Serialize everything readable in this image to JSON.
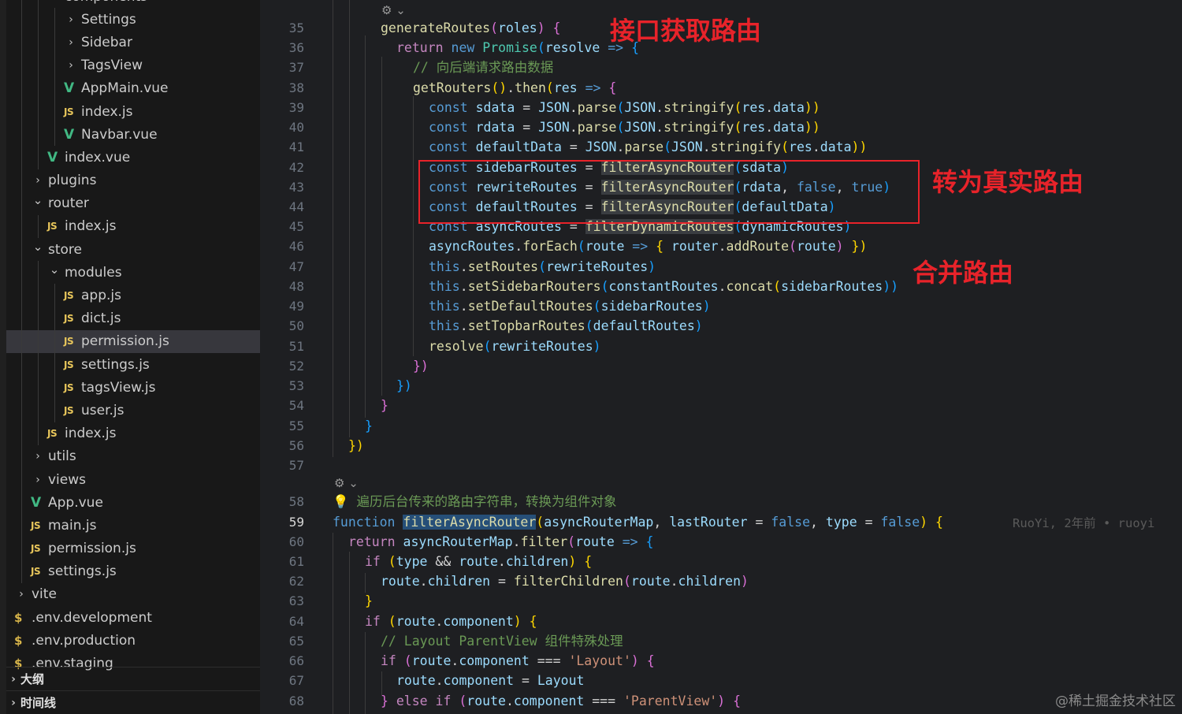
{
  "sidebar": {
    "items": [
      {
        "label": "components",
        "type": "folder-open",
        "depth": 2
      },
      {
        "label": "Settings",
        "type": "folder",
        "depth": 3
      },
      {
        "label": "Sidebar",
        "type": "folder",
        "depth": 3
      },
      {
        "label": "TagsView",
        "type": "folder",
        "depth": 3
      },
      {
        "label": "AppMain.vue",
        "type": "vue",
        "depth": 3
      },
      {
        "label": "index.js",
        "type": "js",
        "depth": 3
      },
      {
        "label": "Navbar.vue",
        "type": "vue",
        "depth": 3
      },
      {
        "label": "index.vue",
        "type": "vue",
        "depth": 2
      },
      {
        "label": "plugins",
        "type": "folder",
        "depth": 1
      },
      {
        "label": "router",
        "type": "folder-open",
        "depth": 1
      },
      {
        "label": "index.js",
        "type": "js",
        "depth": 2
      },
      {
        "label": "store",
        "type": "folder-open",
        "depth": 1
      },
      {
        "label": "modules",
        "type": "folder-open",
        "depth": 2
      },
      {
        "label": "app.js",
        "type": "js",
        "depth": 3
      },
      {
        "label": "dict.js",
        "type": "js",
        "depth": 3
      },
      {
        "label": "permission.js",
        "type": "js",
        "depth": 3,
        "selected": true
      },
      {
        "label": "settings.js",
        "type": "js",
        "depth": 3
      },
      {
        "label": "tagsView.js",
        "type": "js",
        "depth": 3
      },
      {
        "label": "user.js",
        "type": "js",
        "depth": 3
      },
      {
        "label": "index.js",
        "type": "js",
        "depth": 2
      },
      {
        "label": "utils",
        "type": "folder",
        "depth": 1
      },
      {
        "label": "views",
        "type": "folder",
        "depth": 1
      },
      {
        "label": "App.vue",
        "type": "vue",
        "depth": 1
      },
      {
        "label": "main.js",
        "type": "js",
        "depth": 1
      },
      {
        "label": "permission.js",
        "type": "js",
        "depth": 1
      },
      {
        "label": "settings.js",
        "type": "js",
        "depth": 1
      },
      {
        "label": "vite",
        "type": "folder",
        "depth": 0
      },
      {
        "label": ".env.development",
        "type": "env",
        "depth": 0
      },
      {
        "label": ".env.production",
        "type": "env",
        "depth": 0
      },
      {
        "label": ".env.staging",
        "type": "env",
        "depth": 0
      }
    ],
    "panels": [
      {
        "label": "大纲"
      },
      {
        "label": "时间线"
      }
    ]
  },
  "icons": {
    "js": "JS",
    "vue": "V",
    "env": "$",
    "chevron_right": "chevron-right-icon",
    "chevron_down": "chevron-down-icon"
  },
  "editor": {
    "line_numbers": [
      "35",
      "36",
      "37",
      "38",
      "39",
      "40",
      "41",
      "42",
      "43",
      "44",
      "45",
      "46",
      "47",
      "48",
      "49",
      "50",
      "51",
      "52",
      "53",
      "54",
      "55",
      "56",
      "57",
      "58",
      "59",
      "60",
      "61",
      "62",
      "63",
      "64",
      "65",
      "66",
      "67",
      "68"
    ],
    "active_line": "59",
    "blame": "RuoYi, 2年前 • ruoyi",
    "lines": {
      "l35": [
        "generateRoutes",
        "(",
        "roles",
        ")",
        " {"
      ],
      "l36": [
        "return",
        " new ",
        "Promise",
        "(",
        "resolve",
        " => ",
        "{"
      ],
      "l37": "// 向后端请求路由数据",
      "l38": [
        "getRouters",
        "()",
        ".",
        "then",
        "(",
        "res",
        " => ",
        "{"
      ],
      "l39": [
        "const ",
        "sdata",
        " = ",
        "JSON",
        ".",
        "parse",
        "(",
        "JSON",
        ".",
        "stringify",
        "(",
        "res",
        ".",
        "data",
        "))"
      ],
      "l40": [
        "const ",
        "rdata",
        " = ",
        "JSON",
        ".",
        "parse",
        "(",
        "JSON",
        ".",
        "stringify",
        "(",
        "res",
        ".",
        "data",
        "))"
      ],
      "l41": [
        "const ",
        "defaultData",
        " = ",
        "JSON",
        ".",
        "parse",
        "(",
        "JSON",
        ".",
        "stringify",
        "(",
        "res",
        ".",
        "data",
        "))"
      ],
      "l42": [
        "const ",
        "sidebarRoutes",
        " = ",
        "filterAsyncRouter",
        "(",
        "sdata",
        ")"
      ],
      "l43": [
        "const ",
        "rewriteRoutes",
        " = ",
        "filterAsyncRouter",
        "(",
        "rdata",
        ", ",
        "false",
        ", ",
        "true",
        ")"
      ],
      "l44": [
        "const ",
        "defaultRoutes",
        " = ",
        "filterAsyncRouter",
        "(",
        "defaultData",
        ")"
      ],
      "l45": [
        "const ",
        "asyncRoutes",
        " = ",
        "filterDynamicRoutes",
        "(",
        "dynamicRoutes",
        ")"
      ],
      "l46": [
        "asyncRoutes",
        ".",
        "forEach",
        "(",
        "route",
        " => ",
        "{ ",
        "router",
        ".",
        "addRoute",
        "(",
        "route",
        ")",
        " })"
      ],
      "l47": [
        "this",
        ".",
        "setRoutes",
        "(",
        "rewriteRoutes",
        ")"
      ],
      "l48": [
        "this",
        ".",
        "setSidebarRouters",
        "(",
        "constantRoutes",
        ".",
        "concat",
        "(",
        "sidebarRoutes",
        "))"
      ],
      "l49": [
        "this",
        ".",
        "setDefaultRoutes",
        "(",
        "sidebarRoutes",
        ")"
      ],
      "l50": [
        "this",
        ".",
        "setTopbarRoutes",
        "(",
        "defaultRoutes",
        ")"
      ],
      "l51": [
        "resolve",
        "(",
        "rewriteRoutes",
        ")"
      ],
      "l52": "})",
      "l53": "})",
      "l54": "}",
      "l55": "}",
      "l56": "})",
      "l58": "遍历后台传来的路由字符串，转换为组件对象",
      "l59": [
        "function ",
        "filterAsyncRouter",
        "(",
        "asyncRouterMap",
        ", ",
        "lastRouter",
        " = ",
        "false",
        ", ",
        "type",
        " = ",
        "false",
        ") {"
      ],
      "l60": [
        "return ",
        "asyncRouterMap",
        ".",
        "filter",
        "(",
        "route",
        " => ",
        "{"
      ],
      "l61": [
        "if",
        " (",
        "type",
        " && ",
        "route",
        ".",
        "children",
        ") {"
      ],
      "l62": [
        "route",
        ".",
        "children",
        " = ",
        "filterChildren",
        "(",
        "route",
        ".",
        "children",
        ")"
      ],
      "l63": "}",
      "l64": [
        "if",
        " (",
        "route",
        ".",
        "component",
        ") {"
      ],
      "l65": "// Layout ParentView 组件特殊处理",
      "l66": [
        "if",
        " (",
        "route",
        ".",
        "component",
        " === ",
        "'Layout'",
        ") {"
      ],
      "l67": [
        "route",
        ".",
        "component",
        " = ",
        "Layout"
      ],
      "l68": [
        "} ",
        "else if",
        " (",
        "route",
        ".",
        "component",
        " === ",
        "'ParentView'",
        ") {"
      ]
    }
  },
  "annotations": {
    "fetch": "接口获取路由",
    "convert": "转为真实路由",
    "merge": "合并路由"
  },
  "watermark": "@稀土掘金技术社区"
}
